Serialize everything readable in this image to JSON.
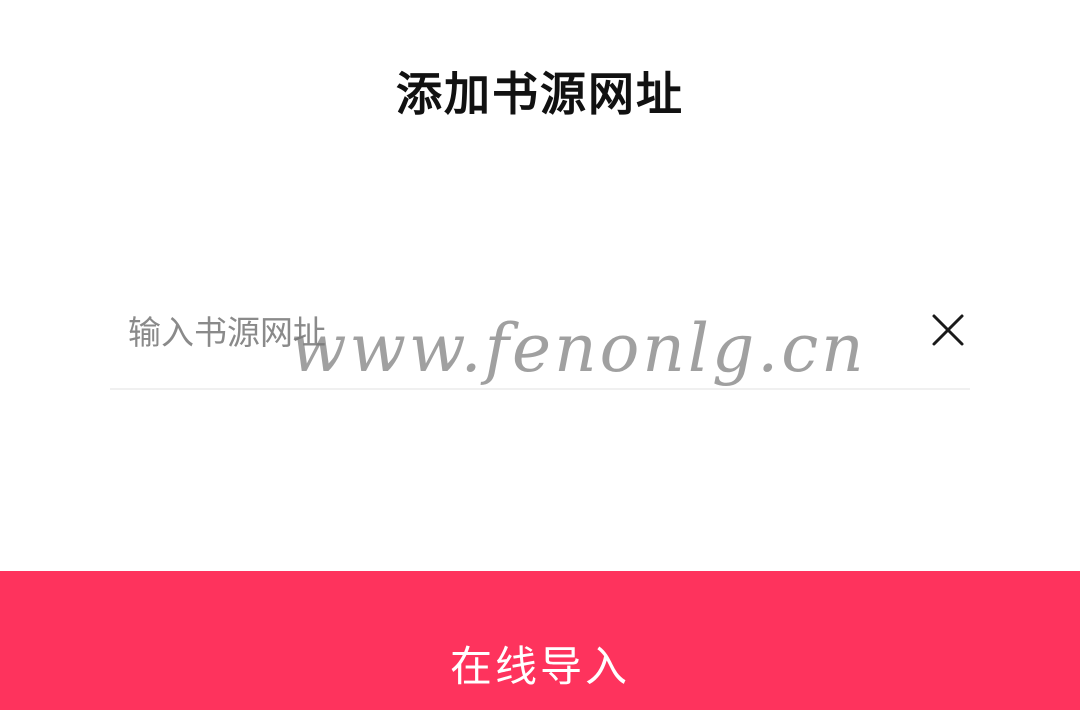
{
  "dialog": {
    "title": "添加书源网址",
    "input": {
      "value": "",
      "placeholder": "输入书源网址"
    },
    "clear_icon": "close-icon",
    "watermark": "www.fenonlg.cn",
    "import_button": {
      "label": "在线导入"
    }
  },
  "colors": {
    "accent": "#fe335d",
    "title_text": "#111111",
    "placeholder_text": "#8a8a8a",
    "divider": "#f0f0f0",
    "background": "#ffffff"
  }
}
